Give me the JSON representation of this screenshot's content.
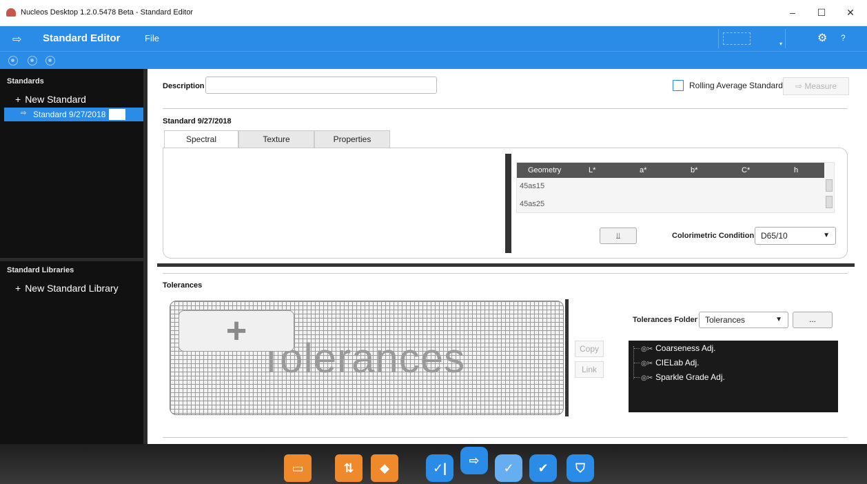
{
  "window": {
    "title": "Nucleos Desktop  1.2.0.5478 Beta - Standard Editor",
    "minimize": "–",
    "maximize": "☐",
    "close": "✕"
  },
  "menubar": {
    "app_title": "Standard Editor",
    "file": "File",
    "gear": "⚙",
    "help": "?",
    "accent": "#2a8ce6"
  },
  "sidebar": {
    "standards_heading": "Standards",
    "new_standard": "New Standard",
    "selected_standard": "Standard 9/27/2018",
    "libraries_heading": "Standard Libraries",
    "new_library": "New Standard Library"
  },
  "main": {
    "description_label": "Description",
    "description_value": "",
    "rolling_label": "Rolling Average Standard",
    "measure_label": "Measure",
    "standard_title": "Standard 9/27/2018",
    "tabs": [
      {
        "label": "Spectral"
      },
      {
        "label": "Texture"
      },
      {
        "label": "Properties"
      }
    ],
    "table": {
      "columns": [
        "Geometry",
        "L*",
        "a*",
        "b*",
        "C*",
        "h"
      ],
      "rows": [
        {
          "geometry": "45as15"
        },
        {
          "geometry": "45as25"
        }
      ]
    },
    "plot_button": "⫫",
    "condition_label": "Colorimetric Condition:",
    "condition_value": "D65/10",
    "tolerances_heading": "Tolerances",
    "tolerances_watermark": "Tolerances",
    "add_symbol": "+",
    "copy_label": "Copy",
    "link_label": "Link",
    "folder_label": "Tolerances Folder",
    "folder_value": "Tolerances",
    "browse_label": "...",
    "tolerance_items": [
      "Coarseness Adj.",
      "CIELab Adj.",
      "Sparkle Grade Adj."
    ]
  },
  "dock": {
    "icons": [
      "folder-icon",
      "import-folder-icon",
      "tag-icon",
      "compare-icon",
      "standard-icon",
      "verify-icon",
      "check-icon",
      "shield-check-icon"
    ]
  }
}
